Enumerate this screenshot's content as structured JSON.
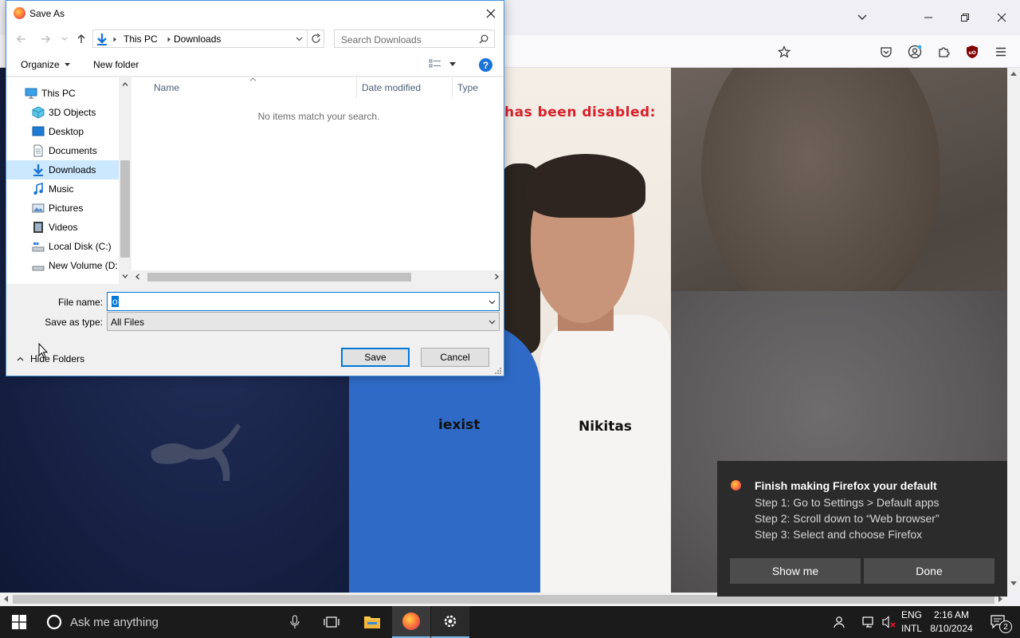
{
  "dialog": {
    "title": "Save As",
    "breadcrumb": [
      "This PC",
      "Downloads"
    ],
    "search_placeholder": "Search Downloads",
    "organize_label": "Organize",
    "new_folder_label": "New folder",
    "tree": [
      {
        "label": "This PC",
        "icon": "computer-icon"
      },
      {
        "label": "3D Objects",
        "icon": "cube-icon"
      },
      {
        "label": "Desktop",
        "icon": "desktop-icon"
      },
      {
        "label": "Documents",
        "icon": "document-icon"
      },
      {
        "label": "Downloads",
        "icon": "download-icon",
        "selected": true
      },
      {
        "label": "Music",
        "icon": "music-icon"
      },
      {
        "label": "Pictures",
        "icon": "picture-icon"
      },
      {
        "label": "Videos",
        "icon": "video-icon"
      },
      {
        "label": "Local Disk (C:)",
        "icon": "drive-icon"
      },
      {
        "label": "New Volume (D:",
        "icon": "drive-icon"
      }
    ],
    "columns": [
      "Name",
      "Date modified",
      "Type"
    ],
    "empty_message": "No items match your search.",
    "file_name_label": "File name:",
    "file_name_value": "o",
    "save_type_label": "Save as type:",
    "save_type_value": "All Files",
    "hide_folders_label": "Hide Folders",
    "save_label": "Save",
    "cancel_label": "Cancel"
  },
  "page": {
    "disabled_text": "has been disabled:",
    "label_left": "iexist",
    "label_right": "Nikitas"
  },
  "notification": {
    "title": "Finish making Firefox your default",
    "steps": [
      "Step 1: Go to Settings > Default apps",
      "Step 2: Scroll down to “Web browser”",
      "Step 3: Select and choose Firefox"
    ],
    "show_me_label": "Show me",
    "done_label": "Done"
  },
  "taskbar": {
    "search_text": "Ask me anything",
    "lang_top": "ENG",
    "lang_bottom": "INTL",
    "time": "2:16 AM",
    "date": "8/10/2024",
    "notification_count": "2"
  },
  "colors": {
    "accent": "#0078d7",
    "toast_bg": "#2b2b2b",
    "taskbar_bg": "#1b1b1b",
    "disabled_text": "#d8202a"
  }
}
